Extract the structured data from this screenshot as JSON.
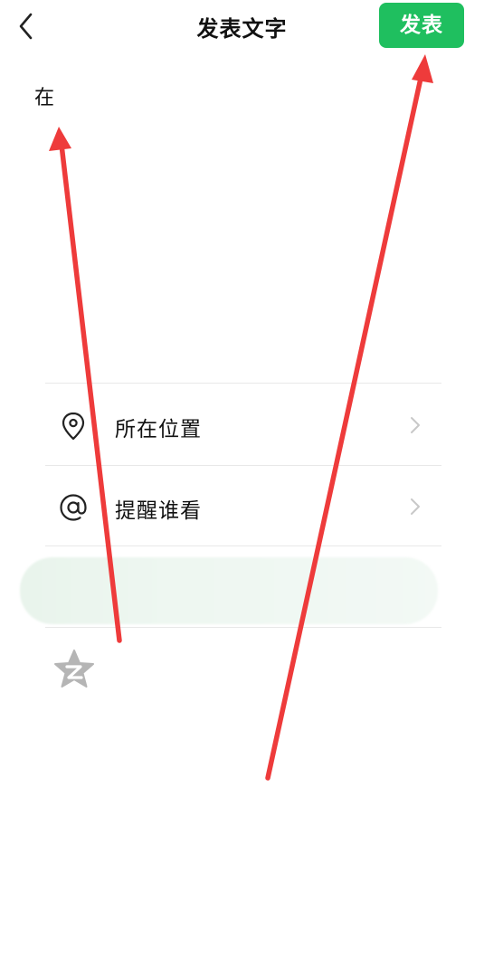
{
  "header": {
    "back_icon": "chevron-left-icon",
    "title": "发表文字",
    "publish_label": "发表",
    "publish_color": "#1fbf5f"
  },
  "compose": {
    "text": "在"
  },
  "options": [
    {
      "icon": "location-pin-icon",
      "label": "所在位置",
      "chevron": "chevron-right-icon"
    },
    {
      "icon": "at-sign-icon",
      "label": "提醒谁看",
      "chevron": "chevron-right-icon"
    }
  ],
  "share": {
    "qzone_icon": "qzone-star-icon"
  },
  "annotations": {
    "arrow_color": "#ee3b3b"
  }
}
